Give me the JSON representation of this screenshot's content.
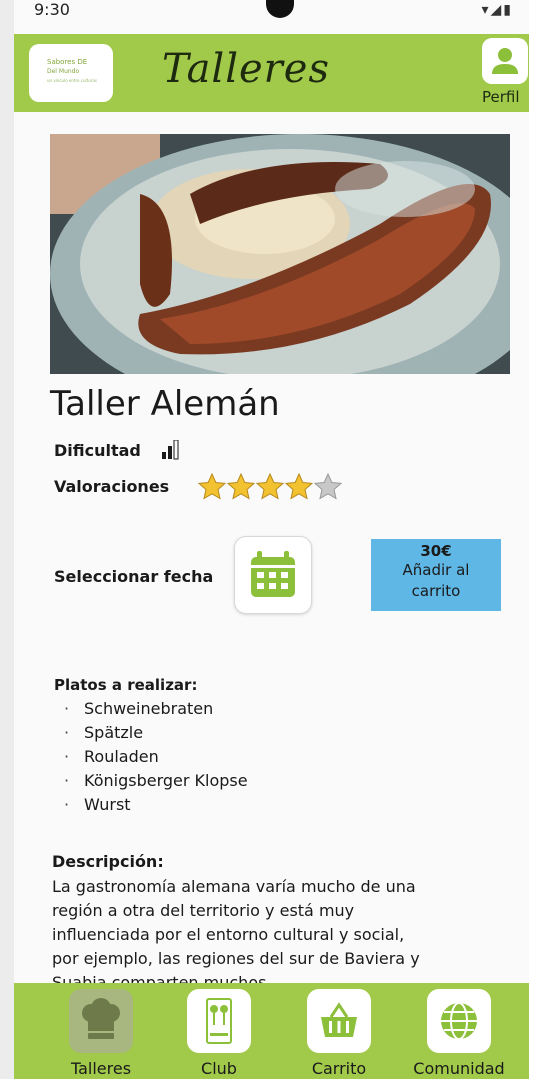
{
  "status_bar": {
    "time": "9:30",
    "icons": "▾◢▮"
  },
  "header": {
    "logo": {
      "line1": "Sabores DE",
      "line2": "Del Mundo",
      "line3": "un vínculo entre culturas"
    },
    "title": "Talleres",
    "profile_label": "Perfil",
    "accent_color": "#a1c94a"
  },
  "workshop": {
    "title": "Taller Alemán",
    "difficulty_label": "Dificultad",
    "difficulty_level": "2 of 3",
    "ratings_label": "Valoraciones",
    "rating": 4,
    "rating_max": 5,
    "date_label": "Seleccionar fecha",
    "date_icon": "calendar-icon",
    "price": "30€",
    "cart_label_line1": "Añadir al",
    "cart_label_line2": "carrito",
    "cart_color": "#5fb7e5"
  },
  "dishes": {
    "title": "Platos a realizar:",
    "items": [
      "Schweinebraten",
      "Spätzle",
      "Rouladen",
      "Königsberger Klopse",
      "Wurst"
    ]
  },
  "description": {
    "title": "Descripción:",
    "text": "La gastronomía alemana varía mucho de una región a otra del territorio y está muy influenciada por el entorno cultural y social, por ejemplo, las regiones del sur de Baviera y Suabia comparten muchos"
  },
  "bottom_nav": {
    "items": [
      {
        "label": "Talleres",
        "icon": "chef-hat-icon",
        "active": true
      },
      {
        "label": "Club",
        "icon": "club-card-icon",
        "active": false
      },
      {
        "label": "Carrito",
        "icon": "basket-icon",
        "active": false
      },
      {
        "label": "Comunidad",
        "icon": "globe-icon",
        "active": false
      }
    ]
  }
}
